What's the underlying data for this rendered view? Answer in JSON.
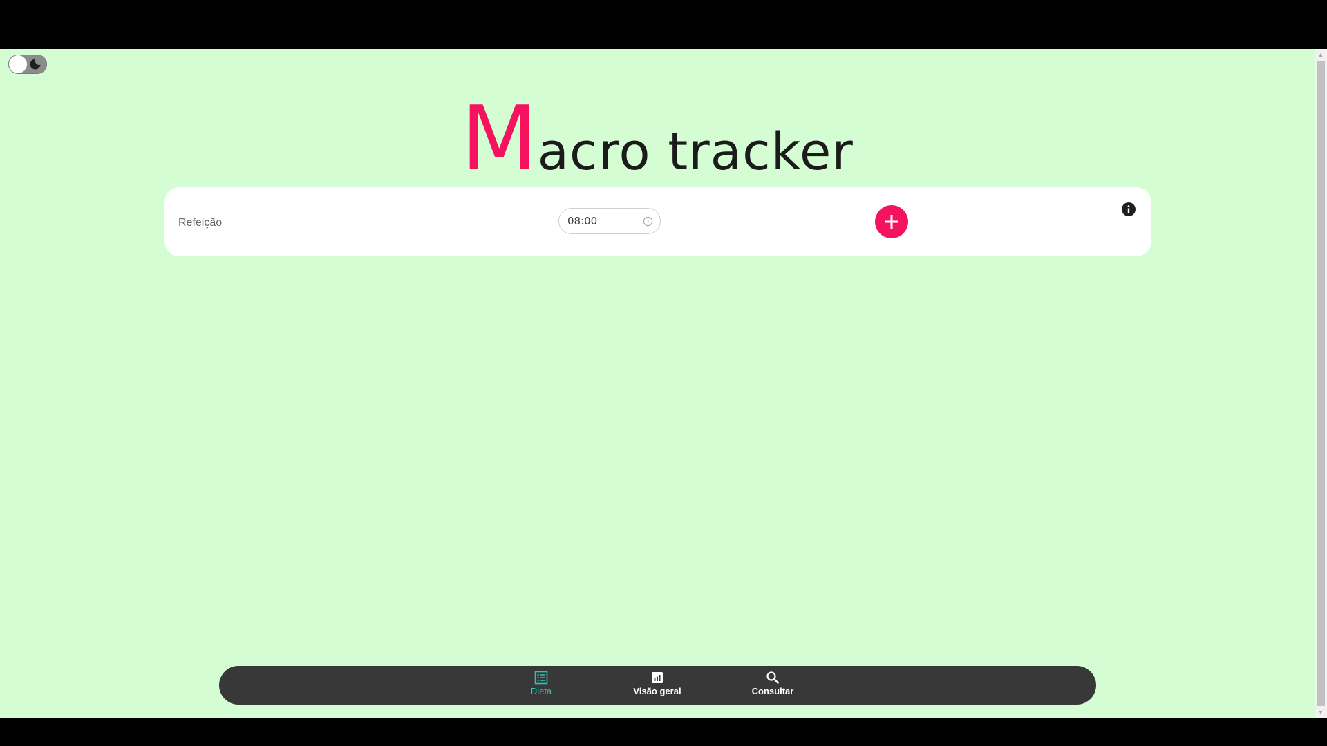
{
  "app": {
    "title_initial": "M",
    "title_rest": "acro tracker"
  },
  "theme_toggle": {
    "state": "light",
    "icon": "moon-icon"
  },
  "meal_form": {
    "meal_placeholder": "Refeição",
    "meal_value": "",
    "time_value": "08:00",
    "time_icon": "clock-icon",
    "add_icon": "plus-icon",
    "info_icon": "info-icon"
  },
  "bottom_nav": {
    "items": [
      {
        "label": "Dieta",
        "icon": "list-icon",
        "active": true
      },
      {
        "label": "Visão geral",
        "icon": "bar-chart-icon",
        "active": false
      },
      {
        "label": "Consultar",
        "icon": "search-icon",
        "active": false
      }
    ]
  },
  "colors": {
    "background": "#d5fdd3",
    "accent": "#f5125f",
    "nav_background": "#383838",
    "nav_active": "#25c9b8"
  }
}
